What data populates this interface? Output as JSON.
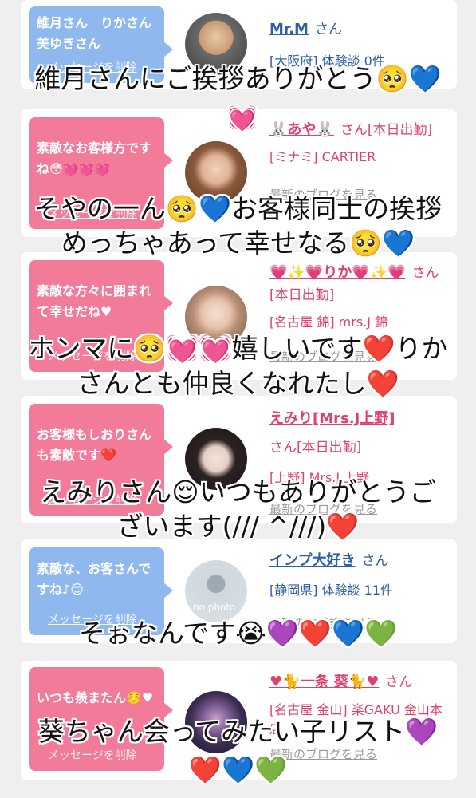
{
  "cards": [
    {
      "bubble": "維月さん　りかさん　美ゆきさん",
      "delete": "メッセージを削除",
      "name": "Mr.M",
      "san": "さん",
      "tag": "[大阪府] 体験談 0件",
      "link": ""
    },
    {
      "bubble": "素敵なお客様方ですね😳💓💓💓",
      "delete": "メッセージを削除",
      "name": "🐰あや🐰",
      "san": "さん[本日出勤]",
      "tag": "[ミナミ] CARTIER",
      "link": "最新のブログを見る"
    },
    {
      "bubble": "素敵な方々に囲まれて幸せだね♥",
      "delete": "メッセージを削除",
      "name": "💗✨💗りか💗✨💗",
      "san": "さん[本日出勤]",
      "tag": "[名古屋 錦] mrs.J 錦",
      "link": "最新のブログを見る"
    },
    {
      "bubble": "お客様もしおりさんも素敵です❤️",
      "delete": "メッセージを削除",
      "name": "えみり[Mrs.J上野]",
      "san": "さん[本日出勤]",
      "tag": "[上野] Mrs.J 上野",
      "link": "最新のブログを見る"
    },
    {
      "bubble": "素敵な、お客さんですね♪😊",
      "delete": "メッセージを削除",
      "name": "インプ大好き",
      "san": "さん",
      "tag": "[静岡県] 体験談 11件",
      "link": "最新の体験談を見る",
      "avatar_text": "no photo"
    },
    {
      "bubble": "いつも羨またん☺️♥",
      "delete": "メッセージを削除",
      "name": "♥🐈一条 葵🐈♥",
      "san": "さん",
      "tag": "[名古屋 金山] 楽GAKU 金山本店",
      "link": "最新のブログを見る"
    }
  ],
  "captions": [
    "維月さんにご挨拶ありがとう🥺💙",
    "💓",
    "そやの一ん🥺💙お客様同士の挨拶",
    "めっちゃあって幸せなる🥺💙",
    "ホンマに🥺💓💓嬉しいです❤️りか",
    "さんとも仲良くなれたし❤️",
    "えみりさん😌いつもありがとうご",
    "ざいます(/// ^///)❤️",
    "そぉなんです😭💜❤️💙💚",
    "葵ちゃん会ってみたい子リスト💜",
    "❤️💙💚"
  ],
  "colors": {
    "blue_bubble": "#8fb8ef",
    "pink_bubble": "#f27b9a",
    "blue_text": "#2c5fa6",
    "pink_text": "#e0406c",
    "background": "#efefef"
  }
}
